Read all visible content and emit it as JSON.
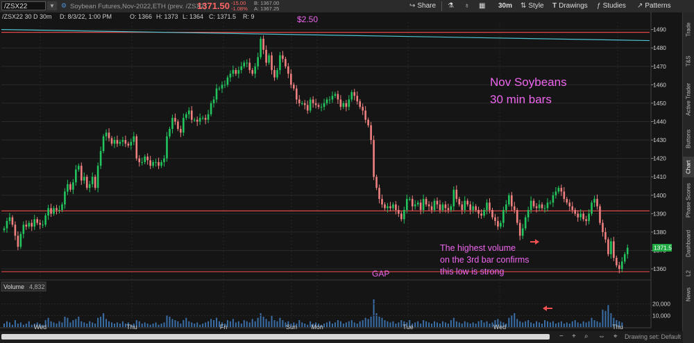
{
  "toolbar": {
    "symbol": "/ZSX22",
    "description": "Soybean Futures,Nov-2022,ETH (prev. /ZSX2)",
    "last_price": "1371.50",
    "change": "-15.00",
    "change_pct": "-1.08%",
    "bid": "B: 1367.00",
    "ask": "A: 1367.25",
    "share_label": "Share",
    "timeframe_label": "30m",
    "style_label": "Style",
    "drawings_label": "Drawings",
    "studies_label": "Studies",
    "patterns_label": "Patterns"
  },
  "chart_header": {
    "info": "/ZSX22 30 D 30m",
    "date": "D: 8/3/22, 1:00 PM",
    "open": "O: 1366",
    "high": "H: 1373",
    "low": "L: 1364",
    "close": "C: 1371.5",
    "r": "R: 9"
  },
  "volume_header": {
    "label": "Volume",
    "value": "4,832"
  },
  "annotations": {
    "title_line1": "Nov Soybeans",
    "title_line2": "30 min bars",
    "note_line1": "The highest volume",
    "note_line2": "on the 3rd bar confirms",
    "note_line3": "this low is strong",
    "gap_label": "GAP",
    "top_label": "$2.50"
  },
  "price_tag": "1371.5",
  "sidebar_tabs": [
    "Trade",
    "T&S",
    "Active Trader",
    "Buttons",
    "Chart",
    "Phase Scores",
    "Dashboard",
    "L2",
    "News"
  ],
  "status_text": "Drawing set: Default",
  "colors": {
    "up": "#22c55e",
    "down": "#f08080",
    "hline": "#e04848",
    "trendline": "#4fc3d0",
    "annotation": "#ee66ee"
  },
  "chart_data": {
    "type": "candlestick",
    "x_day_labels": [
      "Wed",
      "Thu",
      "Fri",
      "Sun",
      "Mon",
      "Tue",
      "Wed",
      "Thu"
    ],
    "y_ticks": [
      1360,
      1370,
      1380,
      1390,
      1400,
      1410,
      1420,
      1430,
      1440,
      1450,
      1460,
      1470,
      1480,
      1490
    ],
    "ylim": [
      1354,
      1494
    ],
    "horizontal_lines": [
      1488.5,
      1391.5,
      1358.5
    ],
    "trendline_endpoints_price": [
      1490,
      1484
    ],
    "close_path": [
      1382,
      1386,
      1388,
      1384,
      1378,
      1372,
      1379,
      1384,
      1383,
      1385,
      1383,
      1387,
      1385,
      1384,
      1384,
      1389,
      1393,
      1390,
      1393,
      1392,
      1392,
      1395,
      1402,
      1406,
      1403,
      1407,
      1414,
      1416,
      1408,
      1410,
      1404,
      1406,
      1410,
      1404,
      1416,
      1424,
      1432,
      1434,
      1431,
      1428,
      1430,
      1428,
      1429,
      1430,
      1428,
      1427,
      1429,
      1432,
      1420,
      1418,
      1418,
      1421,
      1419,
      1416,
      1418,
      1418,
      1416,
      1418,
      1420,
      1432,
      1436,
      1442,
      1440,
      1436,
      1434,
      1442,
      1444,
      1446,
      1441,
      1441,
      1440,
      1442,
      1442,
      1441,
      1444,
      1450,
      1452,
      1458,
      1458,
      1460,
      1460,
      1464,
      1466,
      1468,
      1466,
      1468,
      1470,
      1472,
      1472,
      1468,
      1466,
      1470,
      1475,
      1485,
      1479,
      1472,
      1476,
      1468,
      1464,
      1468,
      1476,
      1474,
      1470,
      1466,
      1460,
      1458,
      1452,
      1450,
      1450,
      1449,
      1446,
      1452,
      1450,
      1449,
      1448,
      1448,
      1450,
      1452,
      1452,
      1454,
      1455,
      1452,
      1448,
      1450,
      1448,
      1452,
      1456,
      1454,
      1451,
      1448,
      1446,
      1441,
      1438,
      1430,
      1410,
      1404,
      1398,
      1395,
      1393,
      1394,
      1393,
      1395,
      1392,
      1390,
      1387,
      1392,
      1398,
      1398,
      1394,
      1395,
      1396,
      1392,
      1398,
      1395,
      1394,
      1392,
      1397,
      1395,
      1392,
      1395,
      1393,
      1392,
      1394,
      1403,
      1398,
      1395,
      1392,
      1397,
      1395,
      1392,
      1394,
      1392,
      1390,
      1389,
      1392,
      1396,
      1392,
      1388,
      1386,
      1383,
      1385,
      1392,
      1395,
      1400,
      1394,
      1392,
      1385,
      1378,
      1382,
      1388,
      1392,
      1397,
      1394,
      1393,
      1395,
      1393,
      1393,
      1396,
      1396,
      1400,
      1402,
      1404,
      1402,
      1398,
      1396,
      1394,
      1392,
      1390,
      1388,
      1390,
      1387,
      1386,
      1390,
      1396,
      1398,
      1394,
      1385,
      1380,
      1376,
      1368,
      1375,
      1366,
      1362,
      1360,
      1364,
      1368,
      1371.5
    ],
    "volume_axis_ticks": [
      10000,
      20000
    ],
    "volume_ylim": [
      0,
      30000
    ],
    "volume_path": [
      3000,
      5000,
      4000,
      2000,
      6000,
      3000,
      4000,
      2000,
      3000,
      5000,
      2000,
      3000,
      4000,
      3000,
      2000,
      6000,
      8000,
      5000,
      4000,
      3000,
      5000,
      4000,
      9000,
      8000,
      4000,
      6000,
      7000,
      9000,
      5000,
      4000,
      3000,
      5000,
      4000,
      3000,
      8000,
      9000,
      12000,
      7000,
      5000,
      4000,
      3000,
      4000,
      3000,
      5000,
      3000,
      4000,
      2000,
      3000,
      6000,
      5000,
      3000,
      4000,
      3000,
      2000,
      3000,
      4000,
      2000,
      3000,
      4000,
      10000,
      9000,
      7000,
      6000,
      5000,
      3000,
      6000,
      8000,
      5000,
      4000,
      3000,
      4000,
      2000,
      3000,
      4000,
      5000,
      7000,
      6000,
      8000,
      5000,
      4000,
      3000,
      6000,
      5000,
      7000,
      4000,
      5000,
      3000,
      6000,
      5000,
      4000,
      7000,
      5000,
      8000,
      12000,
      9000,
      7000,
      5000,
      10000,
      6000,
      5000,
      8000,
      6000,
      4000,
      5000,
      3000,
      4000,
      3000,
      6000,
      4000,
      3000,
      2000,
      5000,
      3000,
      4000,
      3000,
      2000,
      3000,
      4000,
      5000,
      3000,
      4000,
      6000,
      5000,
      3000,
      4000,
      5000,
      6000,
      4000,
      3000,
      5000,
      6000,
      8000,
      7000,
      9000,
      24000,
      12000,
      9000,
      8000,
      6000,
      5000,
      4000,
      5000,
      3000,
      4000,
      6000,
      5000,
      4000,
      6000,
      3000,
      4000,
      5000,
      3000,
      6000,
      5000,
      4000,
      3000,
      5000,
      4000,
      3000,
      5000,
      4000,
      3000,
      6000,
      8000,
      5000,
      4000,
      3000,
      5000,
      4000,
      3000,
      4000,
      3000,
      5000,
      6000,
      4000,
      5000,
      3000,
      4000,
      6000,
      7000,
      5000,
      4000,
      3000,
      8000,
      10000,
      12000,
      7000,
      5000,
      4000,
      5000,
      6000,
      4000,
      3000,
      5000,
      4000,
      3000,
      6000,
      5000,
      4000,
      5000,
      3000,
      4000,
      5000,
      3000,
      4000,
      3000,
      5000,
      6000,
      4000,
      3000,
      5000,
      4000,
      5000,
      8000,
      6000,
      5000,
      4000,
      15000,
      14000,
      19000,
      12000,
      8000,
      6000,
      5000,
      4000
    ]
  }
}
